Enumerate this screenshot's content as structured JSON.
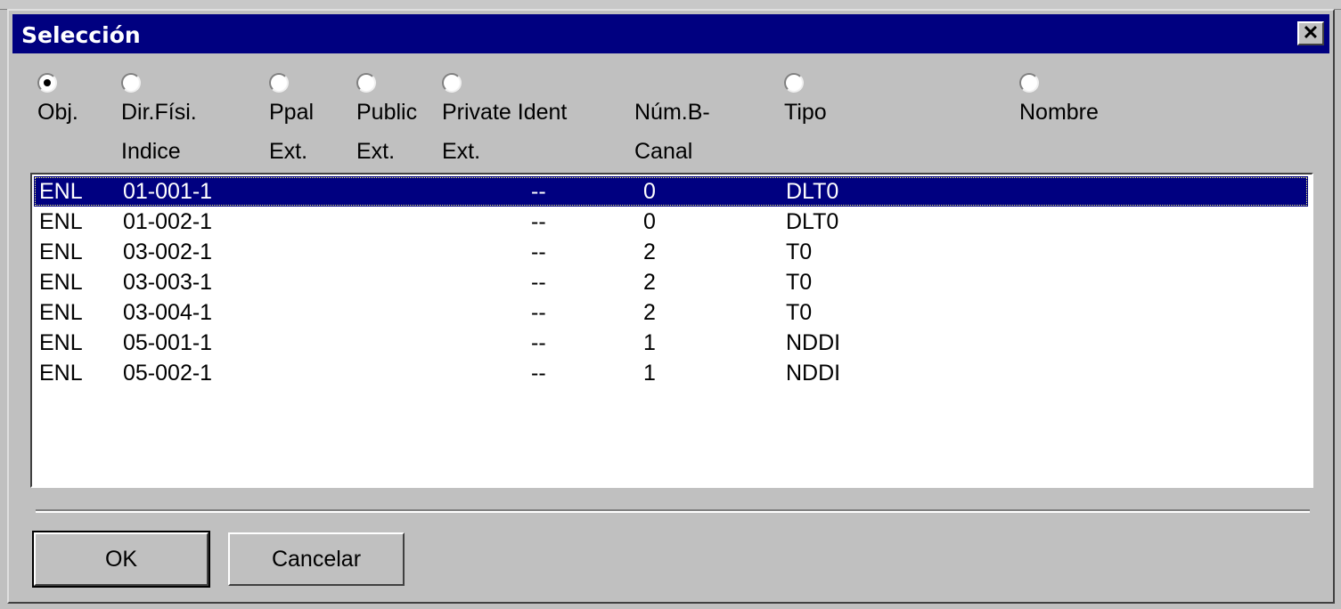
{
  "dialog": {
    "title": "Selección",
    "close_label": "✕"
  },
  "columns": [
    {
      "id": "obj",
      "line1": "Obj.",
      "line2": "",
      "checked": true
    },
    {
      "id": "dir",
      "line1": "Dir.Físi.",
      "line2": "Indice",
      "checked": false
    },
    {
      "id": "ppal",
      "line1": "Ppal",
      "line2": "Ext.",
      "checked": false
    },
    {
      "id": "public",
      "line1": "Public",
      "line2": "Ext.",
      "checked": false
    },
    {
      "id": "private",
      "line1": "Private Ident",
      "line2": "Ext.",
      "checked": false
    },
    {
      "id": "num",
      "line1": "Núm.B-",
      "line2": "Canal",
      "checked": false,
      "no_radio": true
    },
    {
      "id": "tipo",
      "line1": "Tipo",
      "line2": "",
      "checked": false
    },
    {
      "id": "nombre",
      "line1": "Nombre",
      "line2": "",
      "checked": false
    }
  ],
  "rows": [
    {
      "obj": "ENL",
      "dir": "01-001-1",
      "private": "--",
      "num": "0",
      "tipo": "DLT0",
      "selected": true
    },
    {
      "obj": "ENL",
      "dir": "01-002-1",
      "private": "--",
      "num": "0",
      "tipo": "DLT0",
      "selected": false
    },
    {
      "obj": "ENL",
      "dir": "03-002-1",
      "private": "--",
      "num": "2",
      "tipo": "T0",
      "selected": false
    },
    {
      "obj": "ENL",
      "dir": "03-003-1",
      "private": "--",
      "num": "2",
      "tipo": "T0",
      "selected": false
    },
    {
      "obj": "ENL",
      "dir": "03-004-1",
      "private": "--",
      "num": "2",
      "tipo": "T0",
      "selected": false
    },
    {
      "obj": "ENL",
      "dir": "05-001-1",
      "private": "--",
      "num": "1",
      "tipo": "NDDI",
      "selected": false
    },
    {
      "obj": "ENL",
      "dir": "05-002-1",
      "private": "--",
      "num": "1",
      "tipo": "NDDI",
      "selected": false
    }
  ],
  "buttons": {
    "ok": "OK",
    "cancel": "Cancelar"
  },
  "colors": {
    "titlebar": "#000080",
    "selection": "#000080",
    "face": "#c0c0c0"
  }
}
